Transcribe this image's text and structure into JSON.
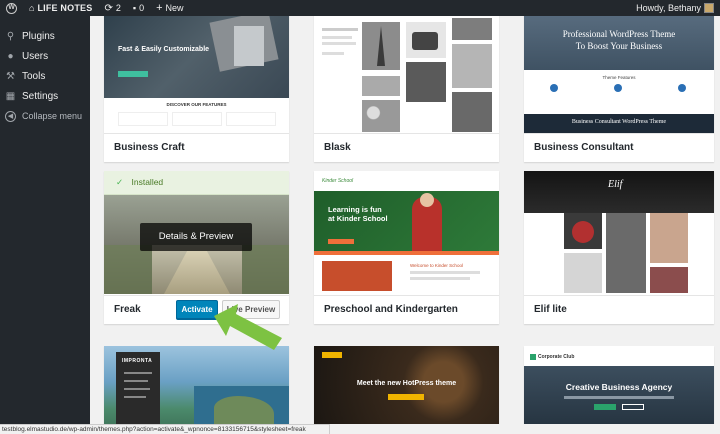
{
  "adminbar": {
    "site_name": "LIFE NOTES",
    "updates_count": "2",
    "comments_count": "0",
    "new_label": "New",
    "howdy": "Howdy, Bethany"
  },
  "sidebar": {
    "items": [
      {
        "label": "Plugins",
        "icon": "plugin-icon"
      },
      {
        "label": "Users",
        "icon": "users-icon"
      },
      {
        "label": "Tools",
        "icon": "tools-icon"
      },
      {
        "label": "Settings",
        "icon": "settings-icon"
      },
      {
        "label": "Collapse menu",
        "icon": "collapse-icon"
      }
    ]
  },
  "themes": {
    "row1": [
      {
        "name": "Business Craft",
        "shot_heading": "Fast & Easily Customizable",
        "shot_subheading": "DISCOVER OUR FEATURES"
      },
      {
        "name": "Blask"
      },
      {
        "name": "Business Consultant",
        "shot_heading": "Professional WordPress Theme\nTo Boost Your Business",
        "shot_caption": "Business Consultant WordPress Theme",
        "shot_tagline": "Theme Features"
      }
    ],
    "row2": [
      {
        "name": "Freak",
        "installed": "Installed",
        "details": "Details & Preview",
        "activate": "Activate",
        "live_preview": "Live Preview"
      },
      {
        "name": "Preschool and Kindergarten",
        "shot_heading": "Learning is fun at Kinder School",
        "shot_sub": "Welcome to Kinder School",
        "shot_logo": "Kinder School"
      },
      {
        "name": "Elif lite",
        "shot_logo": "Elif"
      }
    ],
    "row3": [
      {
        "shot_logo": "IMPRONTA"
      },
      {
        "shot_heading": "Meet the new HotPress theme"
      },
      {
        "shot_heading": "Creative Business Agency",
        "shot_logo": "Corporate Club"
      }
    ]
  },
  "status_url": "testblog.elmastudio.de/wp-admin/themes.php?action=activate&_wpnonce=8133156715&stylesheet=freak",
  "colors": {
    "admin_dark": "#23282d",
    "primary_button": "#0085ba",
    "installed_green": "#46b450",
    "arrow_green": "#7dc242"
  }
}
